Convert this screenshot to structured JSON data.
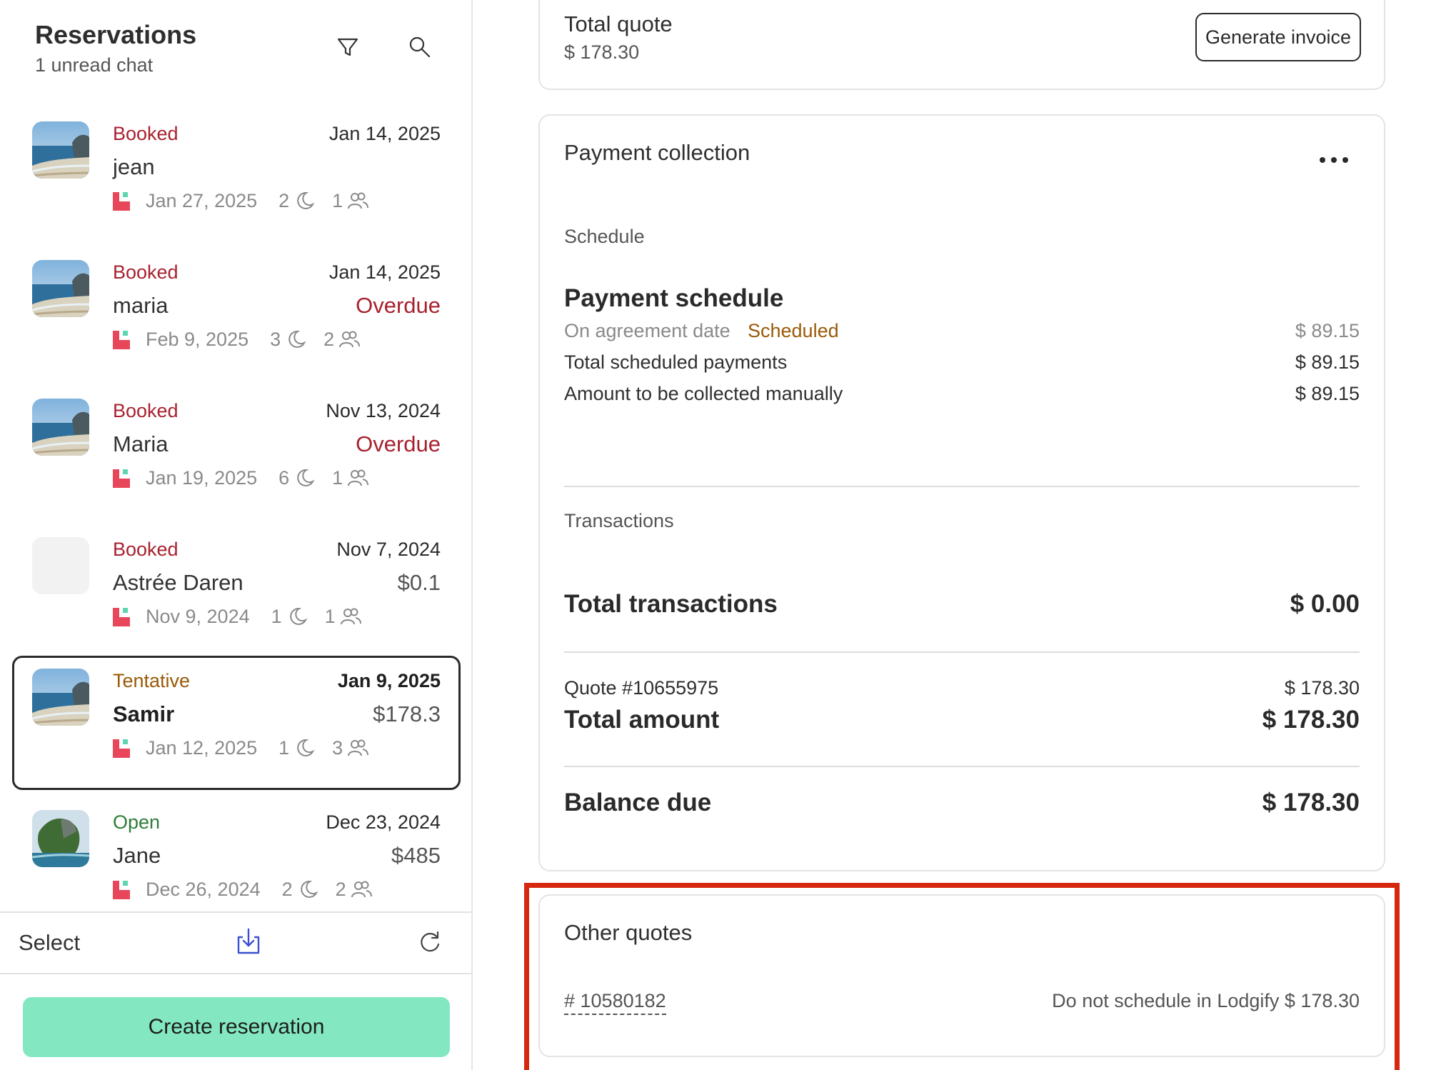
{
  "sidebar": {
    "title": "Reservations",
    "subtitle": "1 unread chat",
    "filter_icon": "funnel-icon",
    "search_icon": "search-icon",
    "reservations": [
      {
        "status": "Booked",
        "date": "Jan 14, 2025",
        "name": "jean",
        "amount": "",
        "checkin": "Jan 27, 2025",
        "nights": "2",
        "guests": "1"
      },
      {
        "status": "Booked",
        "date": "Jan 14, 2025",
        "name": "maria",
        "amount": "Overdue",
        "checkin": "Feb 9, 2025",
        "nights": "3",
        "guests": "2"
      },
      {
        "status": "Booked",
        "date": "Nov 13, 2024",
        "name": "Maria",
        "amount": "Overdue",
        "checkin": "Jan 19, 2025",
        "nights": "6",
        "guests": "1"
      },
      {
        "status": "Booked",
        "date": "Nov 7, 2024",
        "name": "Astrée Daren",
        "amount": "$0.1",
        "checkin": "Nov 9, 2024",
        "nights": "1",
        "guests": "1"
      },
      {
        "status": "Tentative",
        "date": "Jan 9, 2025",
        "name": "Samir",
        "amount": "$178.3",
        "checkin": "Jan 12, 2025",
        "nights": "1",
        "guests": "3"
      },
      {
        "status": "Open",
        "date": "Dec 23, 2024",
        "name": "Jane",
        "amount": "$485",
        "checkin": "Dec 26, 2024",
        "nights": "2",
        "guests": "2"
      }
    ],
    "footer": {
      "select_label": "Select",
      "download_icon": "download-icon",
      "refresh_icon": "refresh-icon"
    },
    "create_button": "Create reservation"
  },
  "quote": {
    "label": "Total quote",
    "value": "$ 178.30",
    "generate_button": "Generate invoice"
  },
  "payment": {
    "title": "Payment collection",
    "schedule_label": "Schedule",
    "schedule_title": "Payment schedule",
    "agreement_label": "On agreement date",
    "agreement_status": "Scheduled",
    "agreement_amount": "$ 89.15",
    "total_scheduled_label": "Total scheduled payments",
    "total_scheduled_value": "$ 89.15",
    "manual_label": "Amount to be collected manually",
    "manual_value": "$ 89.15",
    "transactions_label": "Transactions",
    "total_transactions_label": "Total transactions",
    "total_transactions_value": "$ 0.00",
    "quote_ref_label": "Quote #10655975",
    "quote_ref_value": "$ 178.30",
    "total_amount_label": "Total amount",
    "total_amount_value": "$ 178.30",
    "balance_label": "Balance due",
    "balance_value": "$ 178.30"
  },
  "other_quotes": {
    "title": "Other quotes",
    "quote_id": "# 10580182",
    "detail": "Do not schedule in Lodgify $ 178.30"
  },
  "colors": {
    "booked": "#a8212f",
    "tentative": "#9a5a07",
    "open": "#2f7d3a",
    "create_button": "#83e8c1",
    "highlight": "#d6270f"
  }
}
